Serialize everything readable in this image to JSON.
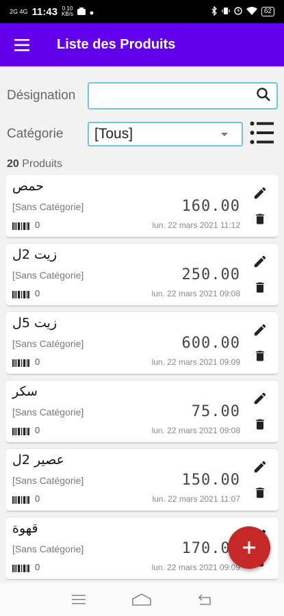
{
  "status_bar": {
    "signal_text": "2G 4G",
    "time": "11:43",
    "speed_value": "0.10",
    "speed_unit": "KB/s",
    "battery": "62"
  },
  "app_bar": {
    "title": "Liste des Produits",
    "menu_icon": "hamburger-menu-icon"
  },
  "filters": {
    "designation_label": "Désignation",
    "designation_value": "",
    "category_label": "Catégorie",
    "category_selected": "[Tous]"
  },
  "summary": {
    "count": "20",
    "count_label": "Produits"
  },
  "products": [
    {
      "name": "حمص",
      "category": "[Sans Catégorie]",
      "price": "160.00",
      "barcodes": "0",
      "date": "lun. 22 mars 2021 11:12"
    },
    {
      "name": "زيت 2ل",
      "category": "[Sans Catégorie]",
      "price": "250.00",
      "barcodes": "0",
      "date": "lun. 22 mars 2021 09:08"
    },
    {
      "name": "زيت 5ل",
      "category": "[Sans Catégorie]",
      "price": "600.00",
      "barcodes": "0",
      "date": "lun. 22 mars 2021 09:09"
    },
    {
      "name": "سكر",
      "category": "[Sans Catégorie]",
      "price": "75.00",
      "barcodes": "0",
      "date": "lun. 22 mars 2021 09:08"
    },
    {
      "name": "عصير 2ل",
      "category": "[Sans Catégorie]",
      "price": "150.00",
      "barcodes": "0",
      "date": "lun. 22 mars 2021 11:07"
    },
    {
      "name": "قهوة",
      "category": "[Sans Catégorie]",
      "price": "170.00",
      "barcodes": "0",
      "date": "lun. 22 mars 2021 09:09"
    }
  ],
  "colors": {
    "app_bar": "#6200ee",
    "field_border": "#6cc5d6",
    "fab": "#c62828"
  },
  "icons": {
    "search": "search-icon",
    "list_view": "list-view-icon",
    "edit": "pencil-icon",
    "delete": "trash-icon",
    "barcode": "barcode-icon",
    "fab": "plus-icon",
    "nav_recents": "recents-icon",
    "nav_home": "home-icon",
    "nav_back": "back-icon"
  }
}
